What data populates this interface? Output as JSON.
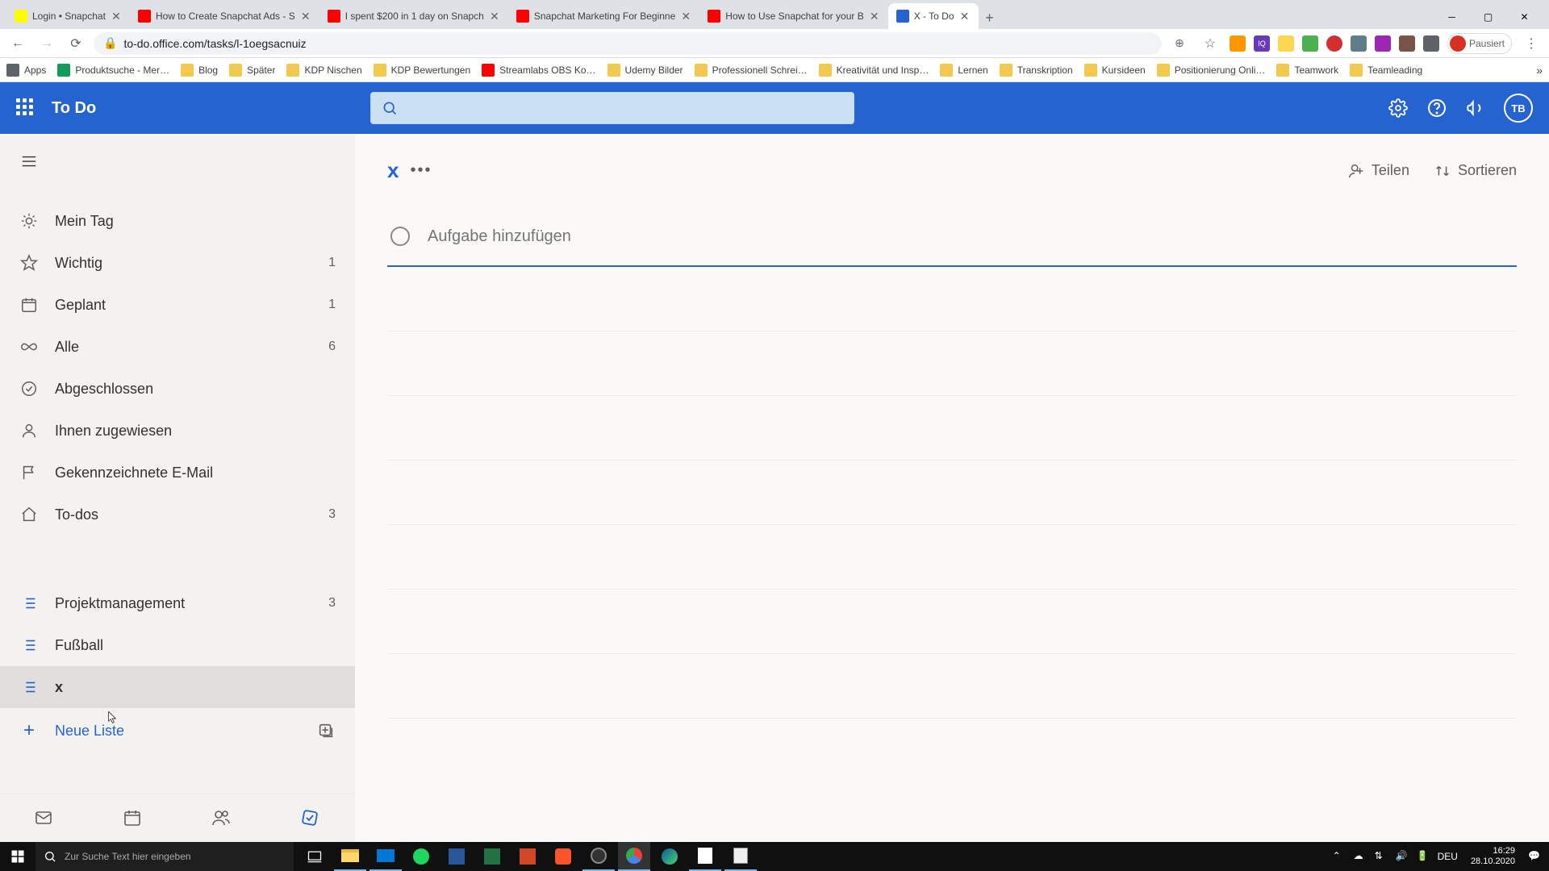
{
  "browser": {
    "tabs": [
      {
        "label": "Login • Snapchat",
        "fav": "#FFFC00"
      },
      {
        "label": "How to Create Snapchat Ads - S",
        "fav": "#FF0000"
      },
      {
        "label": "I spent $200 in 1 day on Snapch",
        "fav": "#FF0000"
      },
      {
        "label": "Snapchat Marketing For Beginne",
        "fav": "#FF0000"
      },
      {
        "label": "How to Use Snapchat for your B",
        "fav": "#FF0000"
      },
      {
        "label": "X - To Do",
        "fav": "#2564cf",
        "active": true
      }
    ],
    "url": "to-do.office.com/tasks/l-1oegsacnuiz",
    "paused": "Pausiert",
    "bookmarks": [
      {
        "label": "Apps",
        "ico": "#5f6368"
      },
      {
        "label": "Produktsuche - Mer…",
        "ico": "#0f9d58"
      },
      {
        "label": "Blog",
        "ico": "#f2c94c"
      },
      {
        "label": "Später",
        "ico": "#f2c94c"
      },
      {
        "label": "KDP Nischen",
        "ico": "#f2c94c"
      },
      {
        "label": "KDP Bewertungen",
        "ico": "#f2c94c"
      },
      {
        "label": "Streamlabs OBS Ko…",
        "ico": "#ff0000"
      },
      {
        "label": "Udemy Bilder",
        "ico": "#f2c94c"
      },
      {
        "label": "Professionell Schrei…",
        "ico": "#f2c94c"
      },
      {
        "label": "Kreativität und Insp…",
        "ico": "#f2c94c"
      },
      {
        "label": "Lernen",
        "ico": "#f2c94c"
      },
      {
        "label": "Transkription",
        "ico": "#f2c94c"
      },
      {
        "label": "Kursideen",
        "ico": "#f2c94c"
      },
      {
        "label": "Positionierung Onli…",
        "ico": "#f2c94c"
      },
      {
        "label": "Teamwork",
        "ico": "#f2c94c"
      },
      {
        "label": "Teamleading",
        "ico": "#f2c94c"
      }
    ]
  },
  "app": {
    "title": "To Do",
    "avatar": "TB",
    "sidebar": {
      "smart": [
        {
          "icon": "sun",
          "label": "Mein Tag",
          "count": ""
        },
        {
          "icon": "star",
          "label": "Wichtig",
          "count": "1"
        },
        {
          "icon": "calendar",
          "label": "Geplant",
          "count": "1"
        },
        {
          "icon": "infinity",
          "label": "Alle",
          "count": "6"
        },
        {
          "icon": "check",
          "label": "Abgeschlossen",
          "count": ""
        },
        {
          "icon": "person",
          "label": "Ihnen zugewiesen",
          "count": ""
        },
        {
          "icon": "flag",
          "label": "Gekennzeichnete E-Mail",
          "count": ""
        },
        {
          "icon": "home",
          "label": "To-dos",
          "count": "3"
        }
      ],
      "lists": [
        {
          "label": "Projektmanagement",
          "count": "3"
        },
        {
          "label": "Fußball",
          "count": ""
        },
        {
          "label": "x",
          "count": "",
          "active": true
        }
      ],
      "newList": "Neue Liste"
    },
    "main": {
      "title": "x",
      "share": "Teilen",
      "sort": "Sortieren",
      "addPlaceholder": "Aufgabe hinzufügen"
    }
  },
  "taskbar": {
    "search": "Zur Suche Text hier eingeben",
    "lang": "DEU",
    "time": "16:29",
    "date": "28.10.2020"
  }
}
